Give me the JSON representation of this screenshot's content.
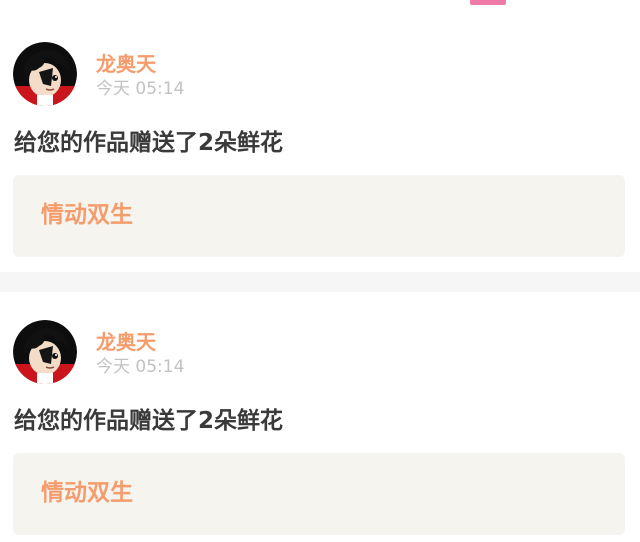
{
  "colors": {
    "accent_orange": "#f59c6c",
    "tab_indicator_pink": "#f07aa8",
    "timestamp_gray": "#c2c2c2",
    "message_text": "#3a3a3a",
    "work_box_bg": "#f5f4ef",
    "divider_bg": "#f6f6f6"
  },
  "notifications": [
    {
      "avatar": "user-avatar-icon",
      "username": "龙奥天",
      "time": "今天 05:14",
      "message": "给您的作品赠送了2朵鲜花",
      "work_title": "情动双生"
    },
    {
      "avatar": "user-avatar-icon",
      "username": "龙奥天",
      "time": "今天 05:14",
      "message": "给您的作品赠送了2朵鲜花",
      "work_title": "情动双生"
    }
  ]
}
